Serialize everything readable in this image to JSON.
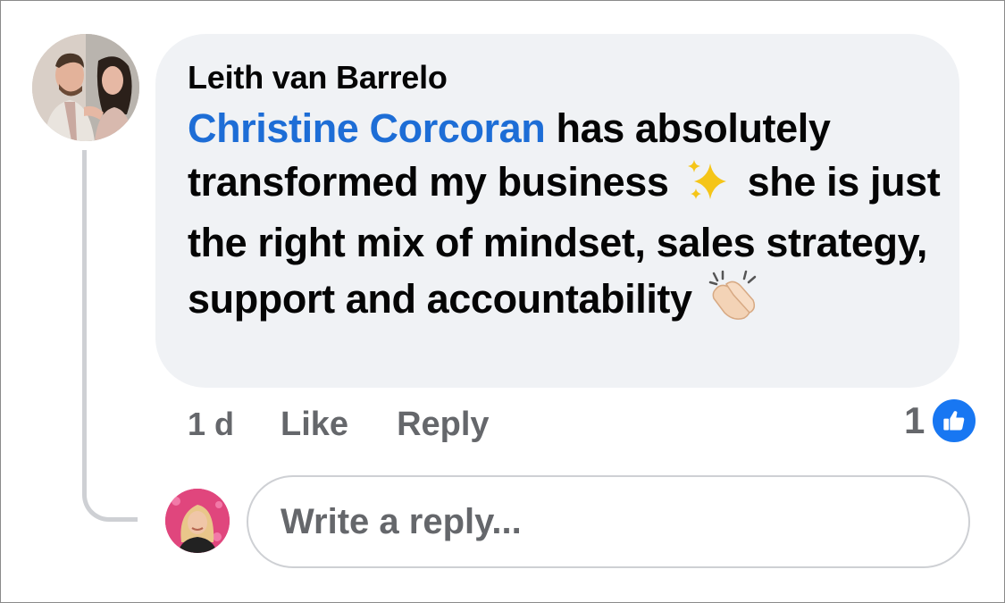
{
  "comment": {
    "author": "Leith van Barrelo",
    "mention": "Christine Corcoran",
    "text_part1": " has absolutely transformed my business ",
    "text_part2": " she is just the right mix of mindset, sales strategy, support and accountability ",
    "emoji_sparkles": "sparkles-icon",
    "emoji_clap": "clapping-hands-icon"
  },
  "actions": {
    "time": "1 d",
    "like_label": "Like",
    "reply_label": "Reply"
  },
  "reactions": {
    "count": "1",
    "icon": "thumbs-up-icon",
    "color": "#1877f2"
  },
  "reply_box": {
    "placeholder": "Write a reply..."
  },
  "colors": {
    "mention": "#1d6dd6",
    "bubble": "#f0f2f5",
    "secondary_text": "#65676b"
  }
}
